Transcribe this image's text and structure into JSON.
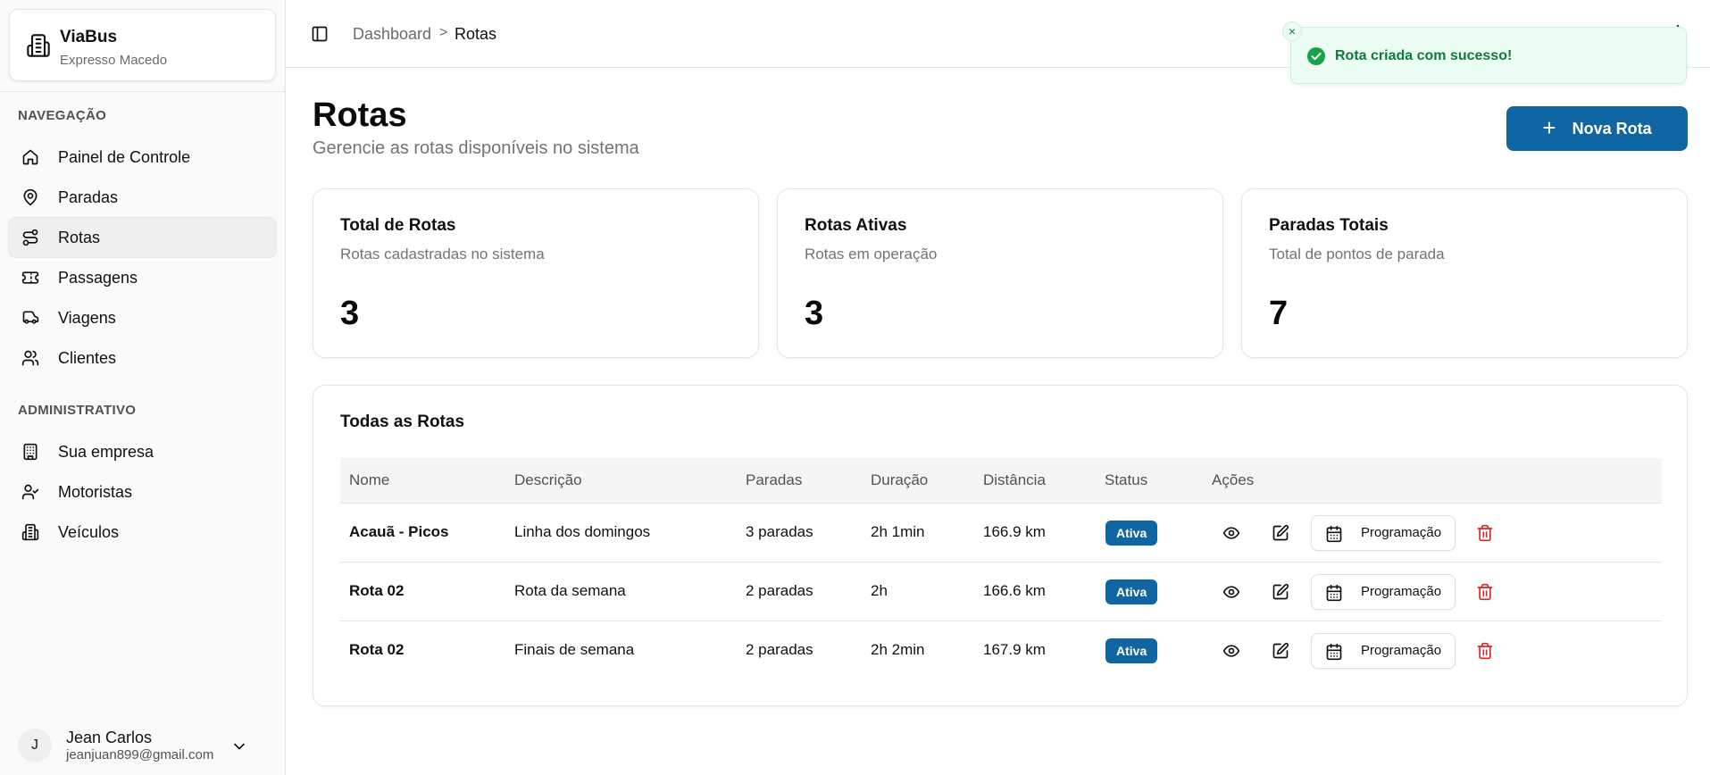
{
  "org": {
    "name": "ViaBus",
    "subtitle": "Expresso Macedo"
  },
  "sidebar": {
    "section_nav": "NAVEGAÇÃO",
    "nav": [
      {
        "label": "Painel de Controle",
        "icon": "home-icon"
      },
      {
        "label": "Paradas",
        "icon": "map-pin-icon"
      },
      {
        "label": "Rotas",
        "icon": "route-icon",
        "active": true
      },
      {
        "label": "Passagens",
        "icon": "ticket-icon"
      },
      {
        "label": "Viagens",
        "icon": "bus-icon"
      },
      {
        "label": "Clientes",
        "icon": "users-icon"
      }
    ],
    "section_admin": "ADMINISTRATIVO",
    "admin": [
      {
        "label": "Sua empresa",
        "icon": "building-icon"
      },
      {
        "label": "Motoristas",
        "icon": "user-check-icon"
      },
      {
        "label": "Veículos",
        "icon": "vehicle-icon"
      }
    ]
  },
  "user": {
    "initial": "J",
    "name": "Jean Carlos",
    "email": "jeanjuan899@gmail.com"
  },
  "breadcrumb": {
    "parent": "Dashboard",
    "separator": ">",
    "current": "Rotas"
  },
  "page": {
    "title": "Rotas",
    "subtitle": "Gerencie as rotas disponíveis no sistema",
    "new_button": "Nova Rota",
    "new_button_icon": "+"
  },
  "stats": [
    {
      "title": "Total de Rotas",
      "subtitle": "Rotas cadastradas no sistema",
      "value": "3"
    },
    {
      "title": "Rotas Ativas",
      "subtitle": "Rotas em operação",
      "value": "3"
    },
    {
      "title": "Paradas Totais",
      "subtitle": "Total de pontos de parada",
      "value": "7"
    }
  ],
  "table": {
    "title": "Todas as Rotas",
    "headers": [
      "Nome",
      "Descrição",
      "Paradas",
      "Duração",
      "Distância",
      "Status",
      "Ações"
    ],
    "rows": [
      {
        "nome": "Acauã - Picos",
        "descricao": "Linha dos domingos",
        "paradas": "3 paradas",
        "duracao": "2h 1min",
        "distancia": "166.9 km",
        "status": "Ativa"
      },
      {
        "nome": "Rota 02",
        "descricao": "Rota da semana",
        "paradas": "2 paradas",
        "duracao": "2h",
        "distancia": "166.6 km",
        "status": "Ativa"
      },
      {
        "nome": "Rota 02",
        "descricao": "Finais de semana",
        "paradas": "2 paradas",
        "duracao": "2h 2min",
        "distancia": "167.9 km",
        "status": "Ativa"
      }
    ],
    "schedule_label": "Programação"
  },
  "toast": {
    "message": "Rota criada com sucesso!",
    "close_icon": "×"
  },
  "colors": {
    "primary": "#0f66a3",
    "danger": "#dc2626",
    "success": "#16a34a",
    "toast_bg": "#ecfdf3"
  }
}
